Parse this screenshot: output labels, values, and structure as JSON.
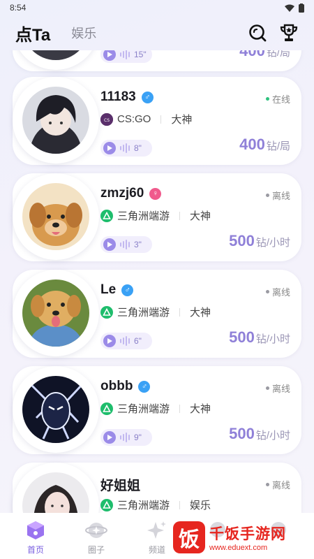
{
  "status_bar": {
    "time": "8:54"
  },
  "header": {
    "tab_active": "点Ta",
    "tab_other": "娱乐"
  },
  "partial_card": {
    "duration": "15\"",
    "price": "400",
    "unit": "钻/局"
  },
  "cards": [
    {
      "name": "11183",
      "gender": "male",
      "status": "在线",
      "online": true,
      "game": "CS:GO",
      "game_icon": "csgo-icon",
      "tag": "大神",
      "duration": "8\"",
      "price": "400",
      "unit": "钻/局"
    },
    {
      "name": "zmzj60",
      "gender": "female",
      "status": "离线",
      "online": false,
      "game": "三角洲端游",
      "game_icon": "delta-icon",
      "tag": "大神",
      "duration": "3\"",
      "price": "500",
      "unit": "钻/小时"
    },
    {
      "name": "Le",
      "gender": "male",
      "status": "离线",
      "online": false,
      "game": "三角洲端游",
      "game_icon": "delta-icon",
      "tag": "大神",
      "duration": "6\"",
      "price": "500",
      "unit": "钻/小时"
    },
    {
      "name": "obbb",
      "gender": "male",
      "status": "离线",
      "online": false,
      "game": "三角洲端游",
      "game_icon": "delta-icon",
      "tag": "大神",
      "duration": "9\"",
      "price": "500",
      "unit": "钻/小时"
    },
    {
      "name": "好姐姐",
      "gender": "female",
      "status": "离线",
      "online": false,
      "game": "三角洲端游",
      "game_icon": "delta-icon",
      "tag": "娱乐"
    }
  ],
  "nav": [
    {
      "label": "首页",
      "icon": "home-icon",
      "active": true
    },
    {
      "label": "圈子",
      "icon": "planet-icon",
      "active": false
    },
    {
      "label": "频道",
      "icon": "sparkle-icon",
      "active": false
    },
    {
      "label": "",
      "icon": "chat-icon",
      "active": false
    },
    {
      "label": "",
      "icon": "profile-icon",
      "active": false
    }
  ],
  "watermark": {
    "title": "千饭手游网",
    "url": "www.eduext.com",
    "logo_char": "饭"
  },
  "colors": {
    "accent": "#7a5fe0",
    "price": "#8f80d8",
    "male": "#3aa1f5",
    "female": "#f05a8c",
    "online": "#2ec27e",
    "offline": "#9a9aa2",
    "delta_game": "#1ebd6c"
  }
}
